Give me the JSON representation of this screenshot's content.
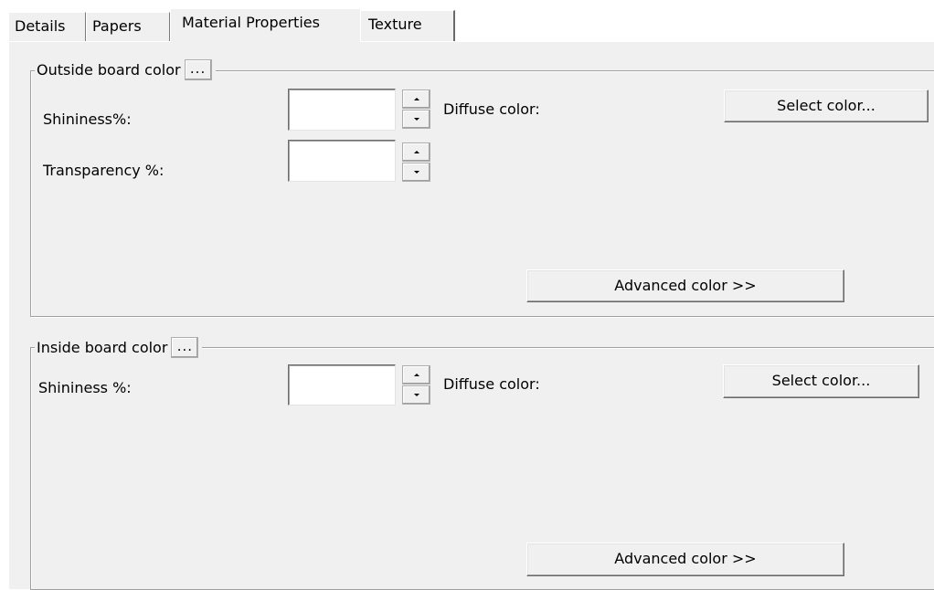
{
  "tabs": [
    {
      "label": "Details"
    },
    {
      "label": "Papers"
    },
    {
      "label": "Material Properties"
    },
    {
      "label": "Texture"
    }
  ],
  "outside": {
    "legend": "Outside board color",
    "legend_button": "...",
    "shininess_label": "Shininess%:",
    "shininess_value": "",
    "transparency_label": "Transparency %:",
    "transparency_value": "",
    "diffuse_label": "Diffuse color:",
    "select_color": "Select color...",
    "advanced_color": "Advanced color >>"
  },
  "inside": {
    "legend": "Inside board color",
    "legend_button": "...",
    "shininess_label": "Shininess %:",
    "shininess_value": "",
    "diffuse_label": "Diffuse color:",
    "select_color": "Select color...",
    "advanced_color": "Advanced color >>"
  }
}
